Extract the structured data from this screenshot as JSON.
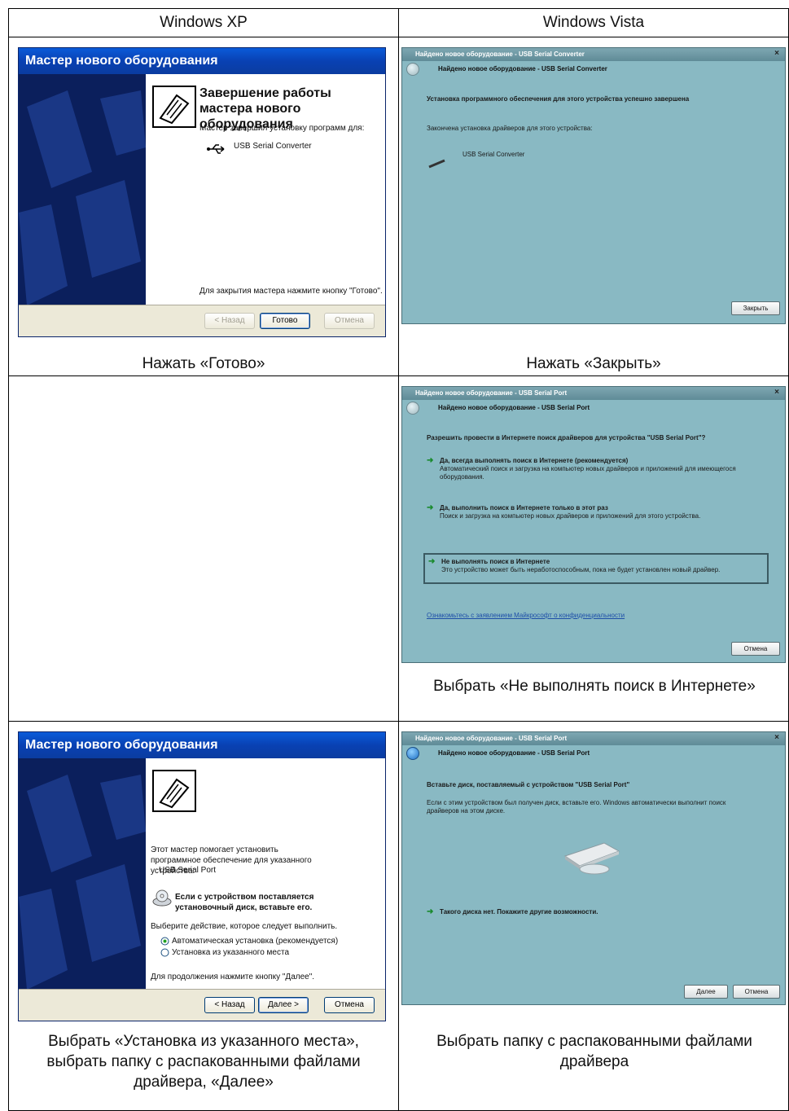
{
  "table": {
    "col_left": "Windows XP",
    "col_right": "Windows Vista"
  },
  "row1": {
    "xp": {
      "title": "Мастер нового оборудования",
      "heading": "Завершение работы мастера нового оборудования",
      "installed_text": "Мастер завершил установку программ для:",
      "device": "USB Serial Converter",
      "close_hint": "Для закрытия мастера нажмите кнопку \"Готово\".",
      "btn_back": "< Назад",
      "btn_finish": "Готово",
      "btn_cancel": "Отмена"
    },
    "vista": {
      "window_title": "Найдено новое оборудование - USB Serial Converter",
      "header": "Найдено новое оборудование - USB Serial Converter",
      "success": "Установка программного обеспечения для этого устройства успешно завершена",
      "finished": "Закончена установка драйверов для этого устройства:",
      "device": "USB Serial Converter",
      "btn_close": "Закрыть"
    },
    "caption_left": "Нажать «Готово»",
    "caption_right": "Нажать «Закрыть»"
  },
  "row2": {
    "vista": {
      "window_title": "Найдено новое оборудование - USB Serial Port",
      "header": "Найдено новое оборудование - USB Serial Port",
      "question": "Разрешить провести в Интернете поиск драйверов для устройства \"USB Serial Port\"?",
      "opt1_title": "Да, всегда выполнять поиск в Интернете (рекомендуется)",
      "opt1_desc": "Автоматический поиск и загрузка на компьютер новых драйверов и приложений для имеющегося оборудования.",
      "opt2_title": "Да, выполнить поиск в Интернете только в этот раз",
      "opt2_desc": "Поиск и загрузка на компьютер новых драйверов и приложений для этого устройства.",
      "opt3_title": "Не выполнять поиск в Интернете",
      "opt3_desc": "Это устройство может быть неработоспособным, пока не будет установлен новый драйвер.",
      "privacy_link": "Ознакомьтесь с заявлением Майкрософт о конфиденциальности",
      "btn_cancel": "Отмена"
    },
    "caption_right": "Выбрать «Не выполнять поиск в Интернете»"
  },
  "row3": {
    "xp": {
      "title": "Мастер нового оборудования",
      "intro": "Этот мастер помогает установить программное обеспечение для указанного устройства:",
      "device": "USB Serial Port",
      "disk_note": "Если с устройством поставляется установочный диск, вставьте его.",
      "choose": "Выберите действие, которое следует выполнить.",
      "radio_auto": "Автоматическая установка (рекомендуется)",
      "radio_manual": "Установка из указанного места",
      "continue_hint": "Для продолжения нажмите кнопку \"Далее\".",
      "btn_back": "< Назад",
      "btn_next": "Далее >",
      "btn_cancel": "Отмена"
    },
    "vista": {
      "window_title": "Найдено новое оборудование - USB Serial Port",
      "header": "Найдено новое оборудование - USB Serial Port",
      "insert_title": "Вставьте диск, поставляемый с устройством \"USB Serial Port\"",
      "insert_desc": "Если с этим устройством был получен диск, вставьте его. Windows автоматически выполнит поиск драйверов на этом диске.",
      "no_disk": "Такого диска нет. Покажите другие возможности.",
      "btn_next": "Далее",
      "btn_cancel": "Отмена"
    },
    "caption_left": "Выбрать «Установка из указанного места», выбрать папку с распакованными файлами драйвера, «Далее»",
    "caption_right": "Выбрать папку с распакованными файлами драйвера"
  }
}
